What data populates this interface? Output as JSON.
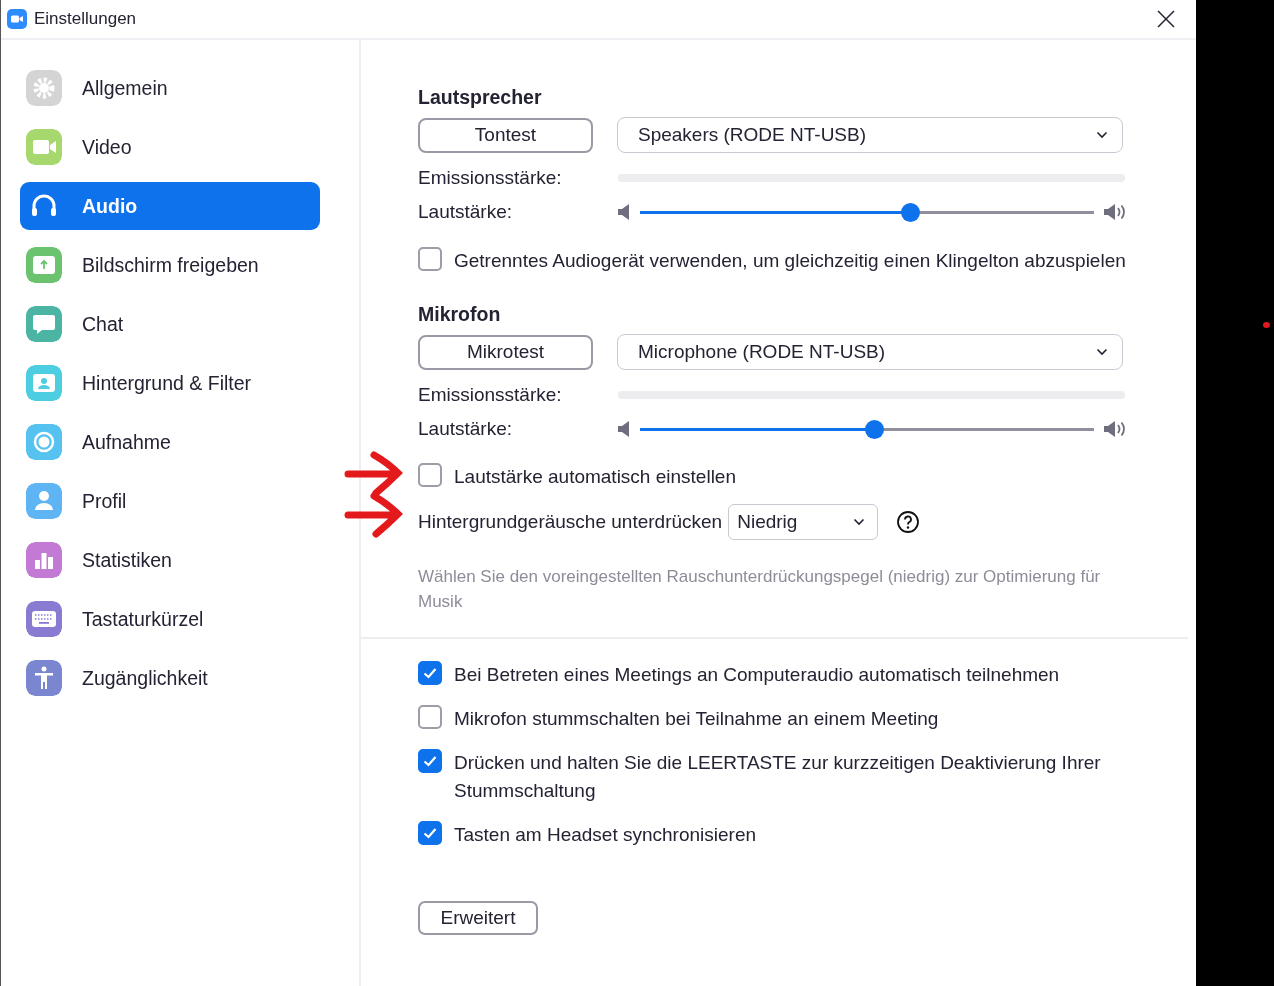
{
  "window": {
    "title": "Einstellungen"
  },
  "sidebar": {
    "items": [
      {
        "label": "Allgemein",
        "kind": "gear",
        "selected": false
      },
      {
        "label": "Video",
        "kind": "camera",
        "selected": false
      },
      {
        "label": "Audio",
        "kind": "headphones",
        "selected": true
      },
      {
        "label": "Bildschirm freigeben",
        "kind": "share",
        "selected": false
      },
      {
        "label": "Chat",
        "kind": "chat",
        "selected": false
      },
      {
        "label": "Hintergrund & Filter",
        "kind": "background",
        "selected": false
      },
      {
        "label": "Aufnahme",
        "kind": "record",
        "selected": false
      },
      {
        "label": "Profil",
        "kind": "profile",
        "selected": false
      },
      {
        "label": "Statistiken",
        "kind": "stats",
        "selected": false
      },
      {
        "label": "Tastaturkürzel",
        "kind": "keyboard",
        "selected": false
      },
      {
        "label": "Zugänglichkeit",
        "kind": "accessibility",
        "selected": false
      }
    ]
  },
  "speaker": {
    "heading": "Lautsprecher",
    "test_button": "Tontest",
    "device": "Speakers (RODE NT-USB)",
    "output_meter": {
      "label": "Emissionsstärke:"
    },
    "volume": {
      "label": "Lautstärke:",
      "level": 0.594
    },
    "separate_device": {
      "label": "Getrenntes Audiogerät verwenden, um gleichzeitig einen Klingelton abzuspielen",
      "checked": false
    }
  },
  "microphone": {
    "heading": "Mikrofon",
    "test_button": "Mikrotest",
    "device": "Microphone (RODE NT-USB)",
    "input_meter": {
      "label": "Emissionsstärke:"
    },
    "volume": {
      "label": "Lautstärke:",
      "level": 0.515
    },
    "auto_volume": {
      "label": "Lautstärke automatisch einstellen",
      "checked": false,
      "annotated": true
    },
    "noise_suppression": {
      "label": "Hintergrundgeräusche unterdrücken",
      "value": "Niedrig",
      "annotated": true
    },
    "description": "Wählen Sie den voreingestellten Rauschunterdrückungspegel (niedrig) zur Optimierung für Musik"
  },
  "options": [
    {
      "label": "Bei Betreten eines Meetings an Computeraudio automatisch teilnehmen",
      "checked": true
    },
    {
      "label": "Mikrofon stummschalten bei Teilnahme an einem Meeting",
      "checked": false
    },
    {
      "label": "Drücken und halten Sie die LEERTASTE zur kurzzeitigen Deaktivierung Ihrer Stummschaltung",
      "checked": true
    },
    {
      "label": "Tasten am Headset synchronisieren",
      "checked": true
    }
  ],
  "advanced_button": "Erweitert"
}
